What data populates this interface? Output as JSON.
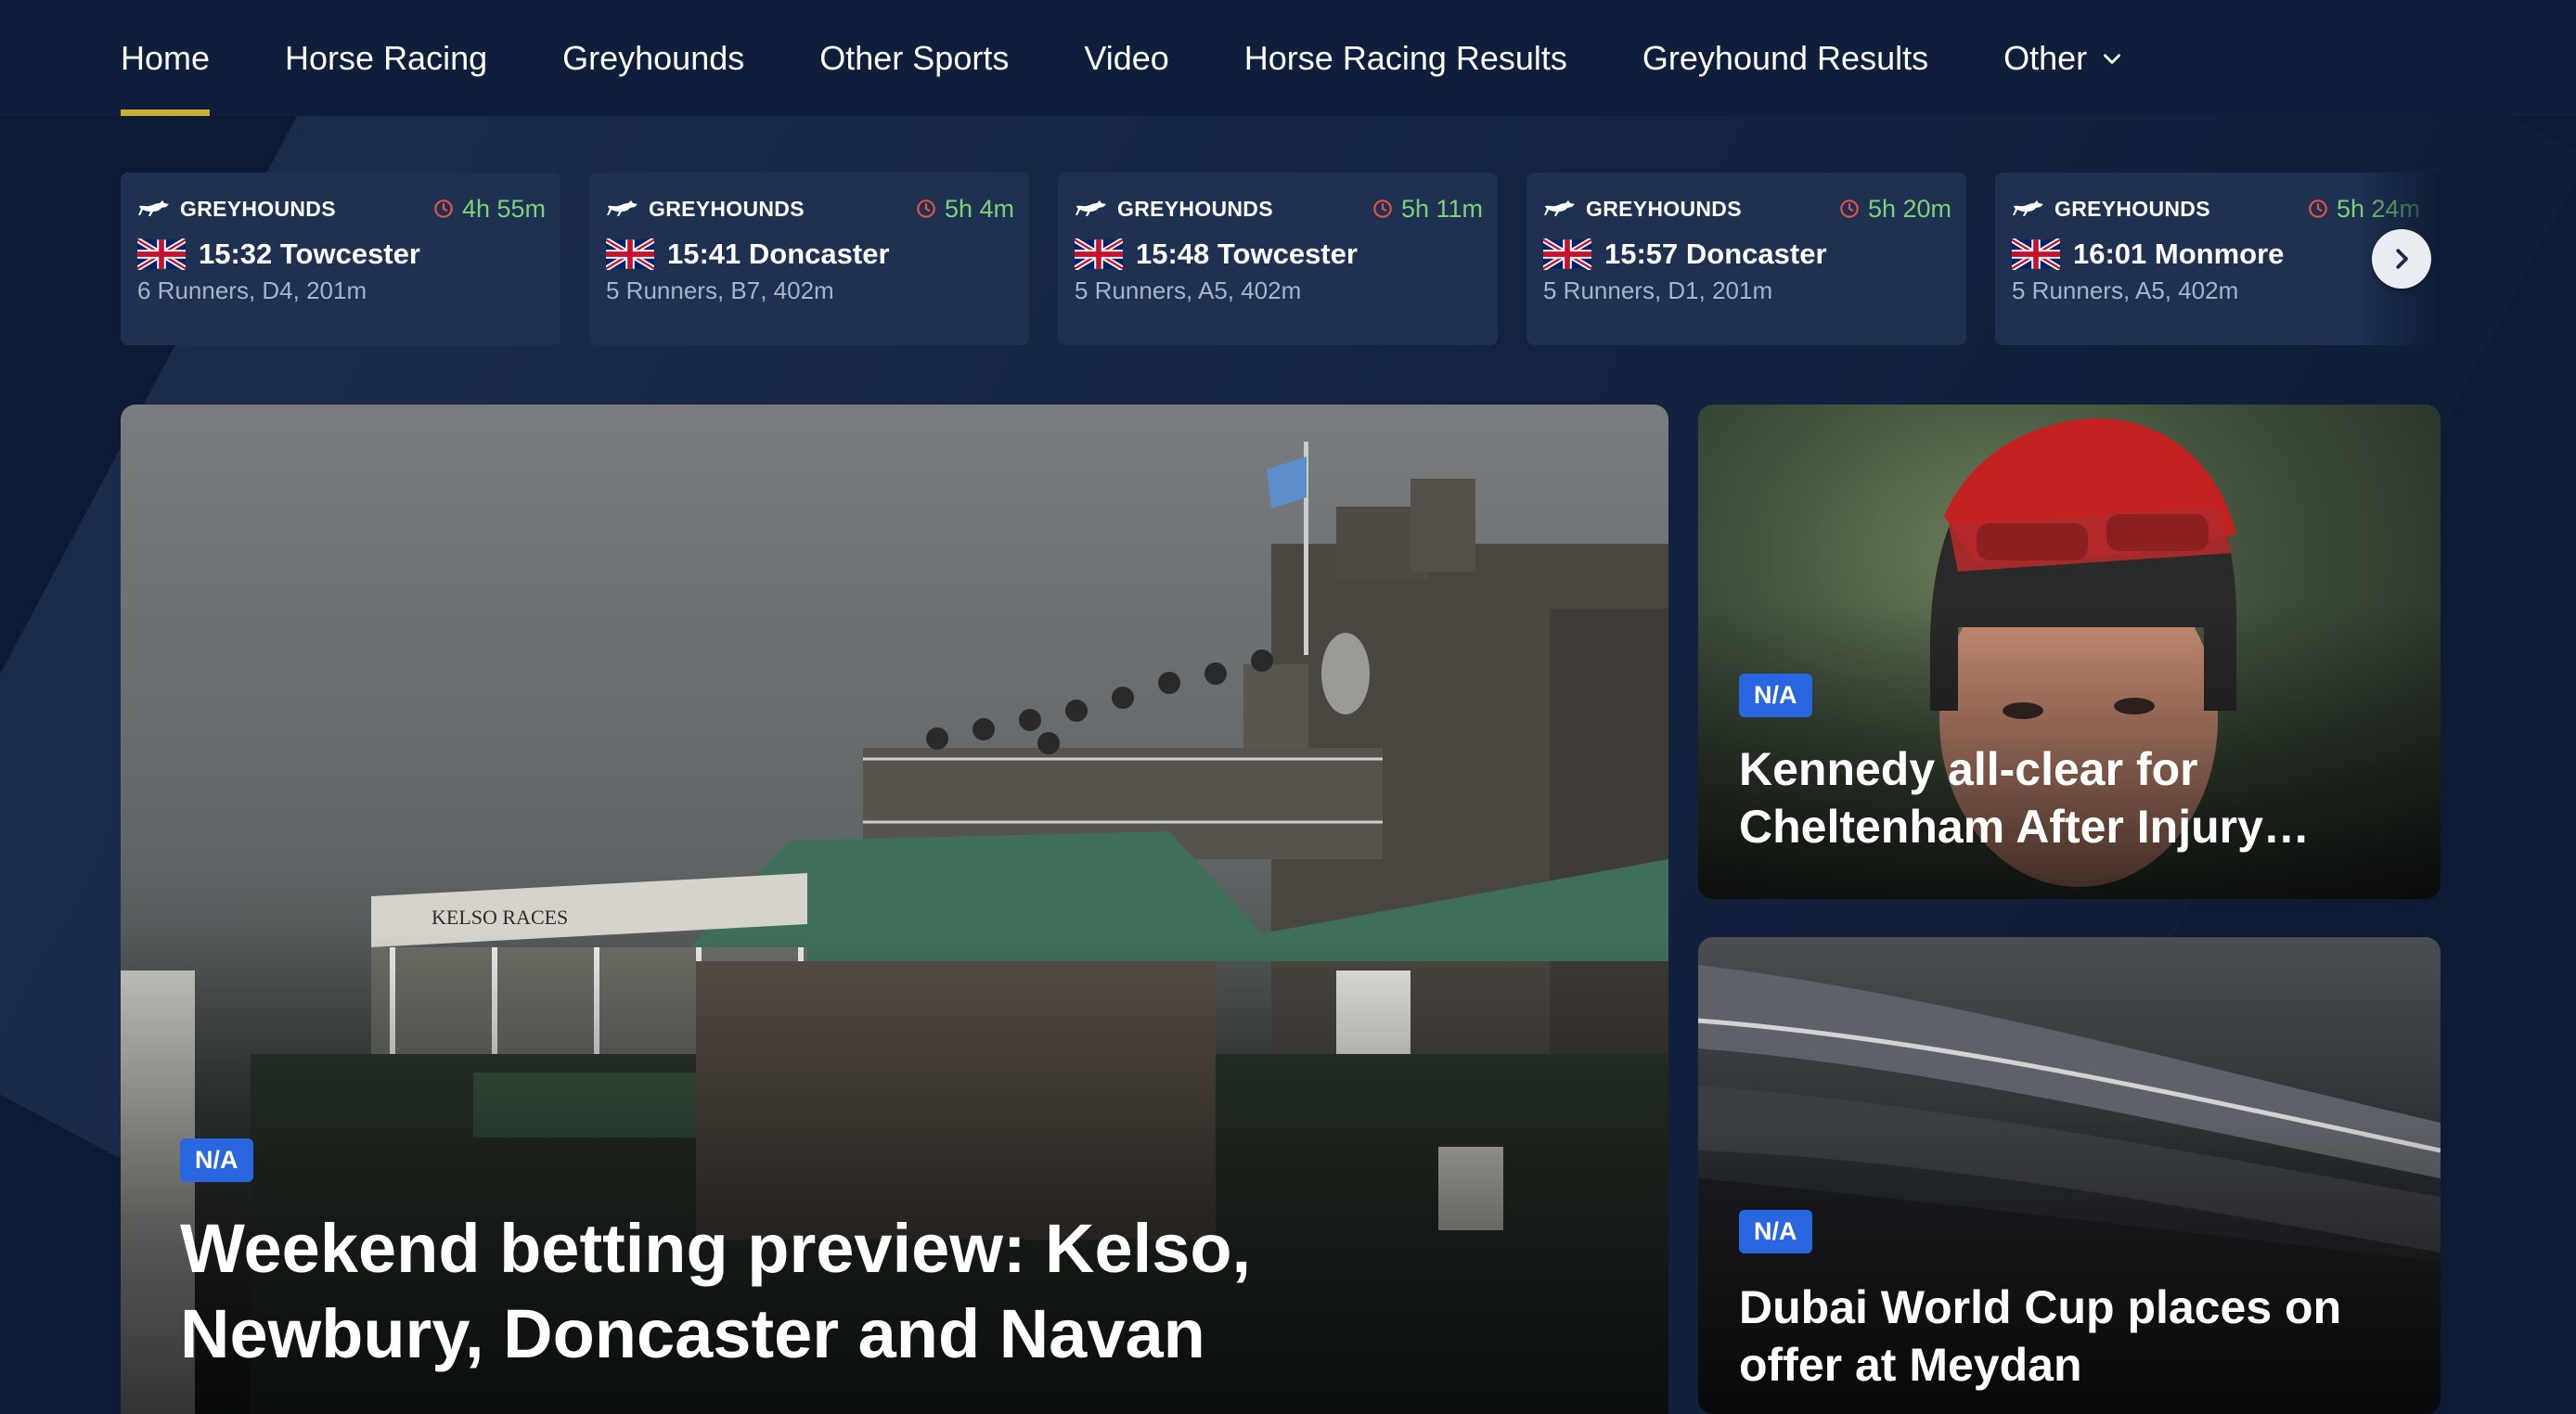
{
  "nav": {
    "items": [
      {
        "label": "Home",
        "active": true
      },
      {
        "label": "Horse Racing"
      },
      {
        "label": "Greyhounds"
      },
      {
        "label": "Other Sports"
      },
      {
        "label": "Video"
      },
      {
        "label": "Horse Racing Results"
      },
      {
        "label": "Greyhound Results"
      },
      {
        "label": "Other"
      }
    ]
  },
  "races": [
    {
      "sport": "GREYHOUNDS",
      "countdown": "4h 55m",
      "title": "15:32 Towcester",
      "details": "6 Runners, D4, 201m"
    },
    {
      "sport": "GREYHOUNDS",
      "countdown": "5h 4m",
      "title": "15:41 Doncaster",
      "details": "5 Runners, B7, 402m"
    },
    {
      "sport": "GREYHOUNDS",
      "countdown": "5h 11m",
      "title": "15:48 Towcester",
      "details": "5 Runners, A5, 402m"
    },
    {
      "sport": "GREYHOUNDS",
      "countdown": "5h 20m",
      "title": "15:57 Doncaster",
      "details": "5 Runners, D1, 201m"
    },
    {
      "sport": "GREYHOUNDS",
      "countdown": "5h 24m",
      "title": "16:01 Monmore",
      "details": "5 Runners, A5, 402m"
    }
  ],
  "hero": {
    "badge": "N/A",
    "title": "Weekend betting preview: Kelso, Newbury, Doncaster and Navan",
    "sign_text": "KELSO RACES"
  },
  "side_articles": [
    {
      "badge": "N/A",
      "title": "Kennedy all-clear for Cheltenham After Injury…"
    },
    {
      "badge": "N/A",
      "title": "Dubai World Cup places on offer at Meydan"
    }
  ],
  "colors": {
    "background": "#0c1a33",
    "nav_background": "#0f1f3b",
    "active_underline": "#c9b233",
    "card_background": "#1e3151",
    "countdown_green": "#7fd07a",
    "clock_red": "#e0524a",
    "badge_blue": "#2a66e0"
  },
  "icons": {
    "nav_dropdown": "chevron-down-icon",
    "race_sport": "greyhound-icon",
    "race_time": "clock-icon",
    "race_country": "uk-flag-icon",
    "carousel_next": "chevron-right-icon"
  }
}
